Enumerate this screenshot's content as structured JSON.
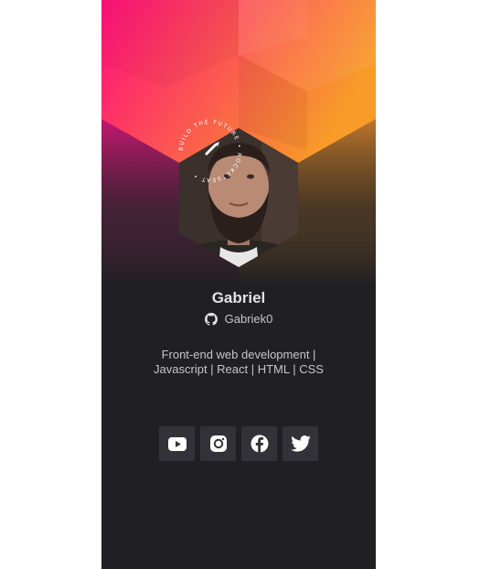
{
  "profile": {
    "name": "Gabriel",
    "github_username": "Gabriek0",
    "bio_line1": "Front-end web development |",
    "bio_line2": "Javascript | React | HTML | CSS",
    "stamp_text": "BUILD THE FUTURE • ROCKETSEAT • "
  },
  "socials": [
    {
      "name": "youtube",
      "icon": "youtube-icon"
    },
    {
      "name": "instagram",
      "icon": "instagram-icon"
    },
    {
      "name": "facebook",
      "icon": "facebook-icon"
    },
    {
      "name": "twitter",
      "icon": "twitter-icon"
    }
  ],
  "colors": {
    "card_bg": "#202024",
    "banner_pink": "#ff0f7b",
    "banner_orange": "#f89b29",
    "button_bg": "#323238",
    "text_primary": "#e1e1e6",
    "text_secondary": "#c4c4cc"
  }
}
